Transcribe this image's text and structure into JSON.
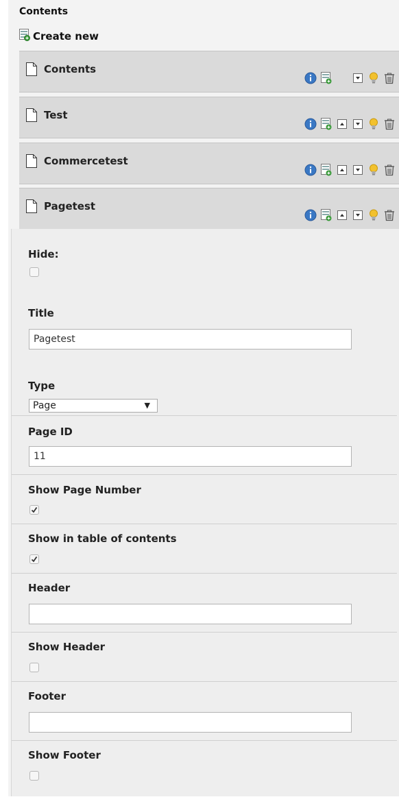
{
  "panel": {
    "title": "Contents"
  },
  "create_new": {
    "label": "Create new",
    "icon": "add-content-icon"
  },
  "items": [
    {
      "label": "Contents",
      "icon": "page-icon"
    },
    {
      "label": "Test",
      "icon": "page-icon"
    },
    {
      "label": "Commercetest",
      "icon": "page-icon"
    },
    {
      "label": "Pagetest",
      "icon": "page-icon"
    }
  ],
  "form": {
    "hide": {
      "label": "Hide:",
      "checked": false
    },
    "title": {
      "label": "Title",
      "value": "Pagetest"
    },
    "type": {
      "label": "Type",
      "selected": "Page"
    },
    "page_id": {
      "label": "Page ID",
      "value": "11"
    },
    "show_page_number": {
      "label": "Show Page Number",
      "checked": true
    },
    "show_in_toc": {
      "label": "Show in table of contents",
      "checked": true
    },
    "header": {
      "label": "Header",
      "value": ""
    },
    "show_header": {
      "label": "Show Header",
      "checked": false
    },
    "footer": {
      "label": "Footer",
      "value": ""
    },
    "show_footer": {
      "label": "Show Footer",
      "checked": false
    }
  },
  "colors": {
    "info_blue": "#3a78c4",
    "bulb_yellow": "#f2c12e",
    "add_green": "#3a9a3a"
  }
}
